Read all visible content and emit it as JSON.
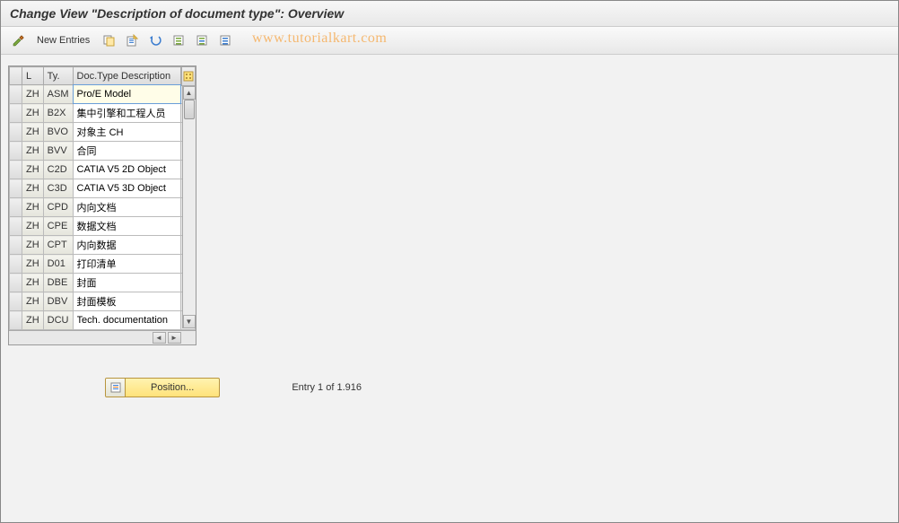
{
  "header": {
    "title": "Change View \"Description of document type\": Overview"
  },
  "toolbar": {
    "new_entries_label": "New Entries"
  },
  "watermark": "www.tutorialkart.com",
  "table": {
    "columns": {
      "lang": "L",
      "type": "Ty.",
      "desc": "Doc.Type Description"
    },
    "rows": [
      {
        "lang": "ZH",
        "type": "ASM",
        "desc": "Pro/E Model"
      },
      {
        "lang": "ZH",
        "type": "B2X",
        "desc": "集中引擎和工程人员"
      },
      {
        "lang": "ZH",
        "type": "BVO",
        "desc": "对象主 CH"
      },
      {
        "lang": "ZH",
        "type": "BVV",
        "desc": "合同"
      },
      {
        "lang": "ZH",
        "type": "C2D",
        "desc": "CATIA V5 2D Object"
      },
      {
        "lang": "ZH",
        "type": "C3D",
        "desc": "CATIA V5 3D Object"
      },
      {
        "lang": "ZH",
        "type": "CPD",
        "desc": "内向文档"
      },
      {
        "lang": "ZH",
        "type": "CPE",
        "desc": "数据文档"
      },
      {
        "lang": "ZH",
        "type": "CPT",
        "desc": "内向数据"
      },
      {
        "lang": "ZH",
        "type": "D01",
        "desc": "打印清单"
      },
      {
        "lang": "ZH",
        "type": "DBE",
        "desc": "封面"
      },
      {
        "lang": "ZH",
        "type": "DBV",
        "desc": "封面模板"
      },
      {
        "lang": "ZH",
        "type": "DCU",
        "desc": "Tech. documentation"
      }
    ]
  },
  "footer": {
    "position_label": "Position...",
    "entry_text": "Entry 1 of 1.916"
  }
}
